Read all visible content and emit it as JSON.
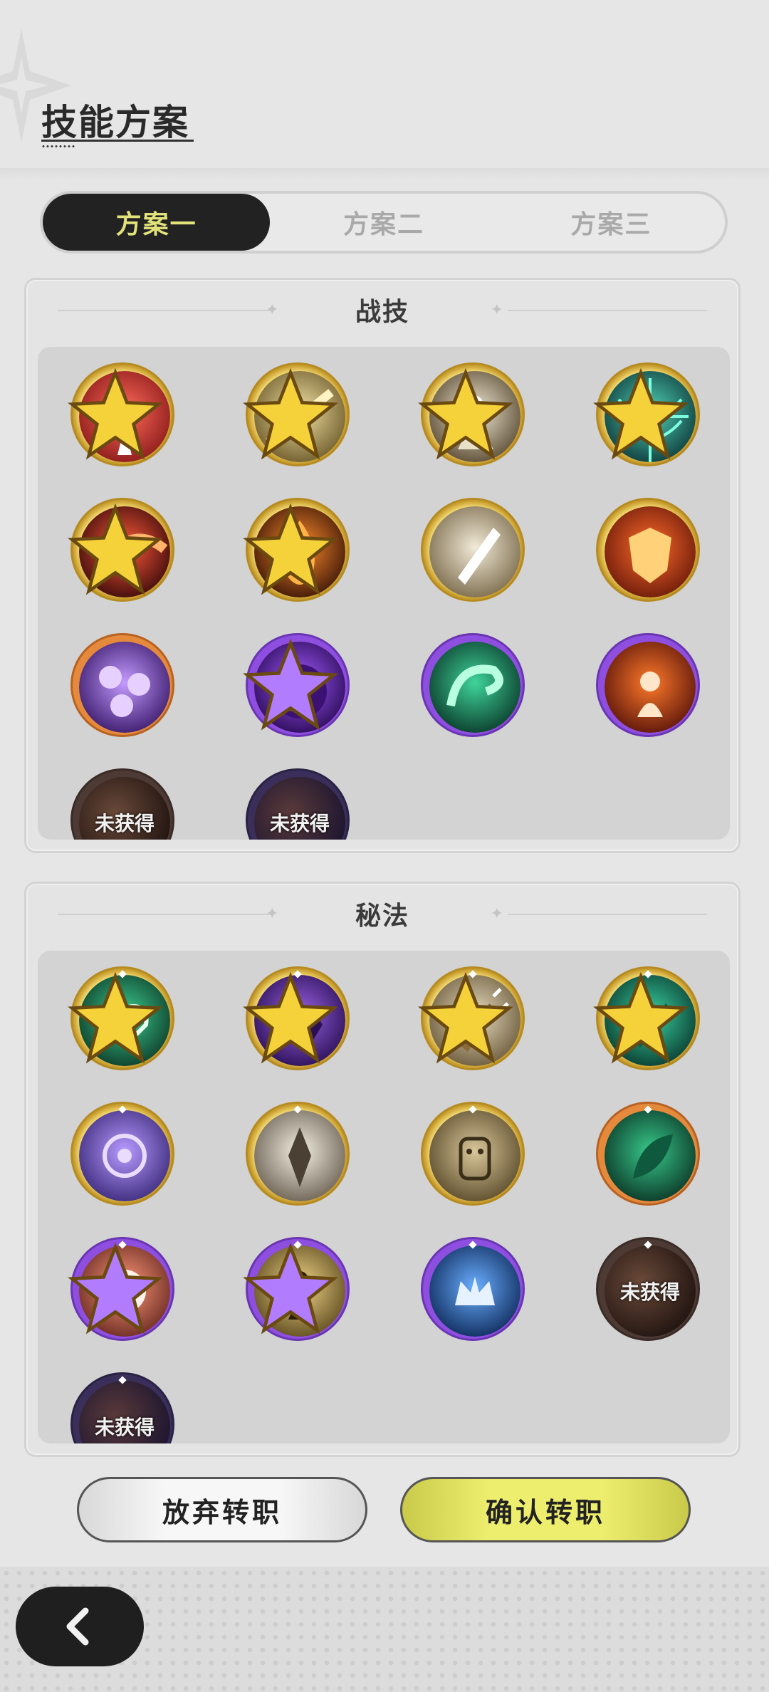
{
  "page": {
    "title": "技能方案"
  },
  "tabs": [
    {
      "label": "方案一",
      "active": true
    },
    {
      "label": "方案二",
      "active": false
    },
    {
      "label": "方案三",
      "active": false
    }
  ],
  "sections": {
    "combat": {
      "title": "战技",
      "icons": [
        {
          "name": "combat-skill-1-icon",
          "ring": "gold",
          "badge": "gold-star",
          "theme": "red-burst"
        },
        {
          "name": "combat-skill-2-icon",
          "ring": "gold",
          "badge": "gold-star",
          "theme": "gold-spear"
        },
        {
          "name": "combat-skill-3-icon",
          "ring": "gold",
          "badge": "gold-star",
          "theme": "white-slash"
        },
        {
          "name": "combat-skill-4-icon",
          "ring": "gold",
          "badge": "gold-star",
          "theme": "teal-web"
        },
        {
          "name": "combat-skill-5-icon",
          "ring": "gold",
          "badge": "gold-star",
          "theme": "red-crescent"
        },
        {
          "name": "combat-skill-6-icon",
          "ring": "gold",
          "badge": "gold-star",
          "theme": "orange-flame"
        },
        {
          "name": "combat-skill-7-icon",
          "ring": "gold",
          "badge": "",
          "theme": "silver-sword"
        },
        {
          "name": "combat-skill-8-icon",
          "ring": "gold",
          "badge": "",
          "theme": "fire-shield"
        },
        {
          "name": "combat-skill-9-icon",
          "ring": "orange",
          "badge": "",
          "theme": "purple-roses"
        },
        {
          "name": "combat-skill-10-icon",
          "ring": "purple",
          "badge": "purple-stars",
          "theme": "purple-ghost"
        },
        {
          "name": "combat-skill-11-icon",
          "ring": "purple",
          "badge": "",
          "theme": "green-wave"
        },
        {
          "name": "combat-skill-12-icon",
          "ring": "purple",
          "badge": "",
          "theme": "fire-figure"
        },
        {
          "name": "combat-skill-locked-1-icon",
          "ring": "brown",
          "badge": "",
          "locked_label": "未获得"
        },
        {
          "name": "combat-skill-locked-2-icon",
          "ring": "dpurple",
          "badge": "",
          "locked_label": "未获得"
        }
      ]
    },
    "secret": {
      "title": "秘法",
      "icons": [
        {
          "name": "secret-art-1-icon",
          "ring": "gold",
          "badge": "gold-star",
          "theme": "green-heart"
        },
        {
          "name": "secret-art-2-icon",
          "ring": "gold",
          "badge": "gold-star",
          "theme": "purple-beast"
        },
        {
          "name": "secret-art-3-icon",
          "ring": "gold",
          "badge": "gold-star",
          "theme": "sword-up"
        },
        {
          "name": "secret-art-4-icon",
          "ring": "gold",
          "badge": "gold-star",
          "theme": "green-blade"
        },
        {
          "name": "secret-art-5-icon",
          "ring": "gold",
          "badge": "",
          "theme": "purple-swirl"
        },
        {
          "name": "secret-art-6-icon",
          "ring": "gold",
          "badge": "",
          "theme": "silver-shard"
        },
        {
          "name": "secret-art-7-icon",
          "ring": "gold",
          "badge": "",
          "theme": "golem"
        },
        {
          "name": "secret-art-8-icon",
          "ring": "orange",
          "badge": "",
          "theme": "green-leaf"
        },
        {
          "name": "secret-art-9-icon",
          "ring": "purple",
          "badge": "purple-stars",
          "theme": "red-explosion"
        },
        {
          "name": "secret-art-10-icon",
          "ring": "purple",
          "badge": "purple-star",
          "theme": "gold-figure"
        },
        {
          "name": "secret-art-11-icon",
          "ring": "purple",
          "badge": "",
          "theme": "blue-crown"
        },
        {
          "name": "secret-art-locked-1-icon",
          "ring": "brown",
          "badge": "",
          "locked_label": "未获得"
        },
        {
          "name": "secret-art-locked-2-icon",
          "ring": "dpurple",
          "badge": "",
          "locked_label": "未获得"
        }
      ]
    }
  },
  "buttons": {
    "cancel_label": "放弃转职",
    "confirm_label": "确认转职"
  },
  "colors": {
    "tab_active_bg": "#222222",
    "tab_active_text": "#e2e27a",
    "confirm_button": "#eded6e",
    "ring_gold": "#f4d661",
    "ring_purple": "#8e4fe0",
    "ring_orange": "#e58a3c"
  },
  "back_button": {
    "icon": "chevron-left-icon"
  }
}
